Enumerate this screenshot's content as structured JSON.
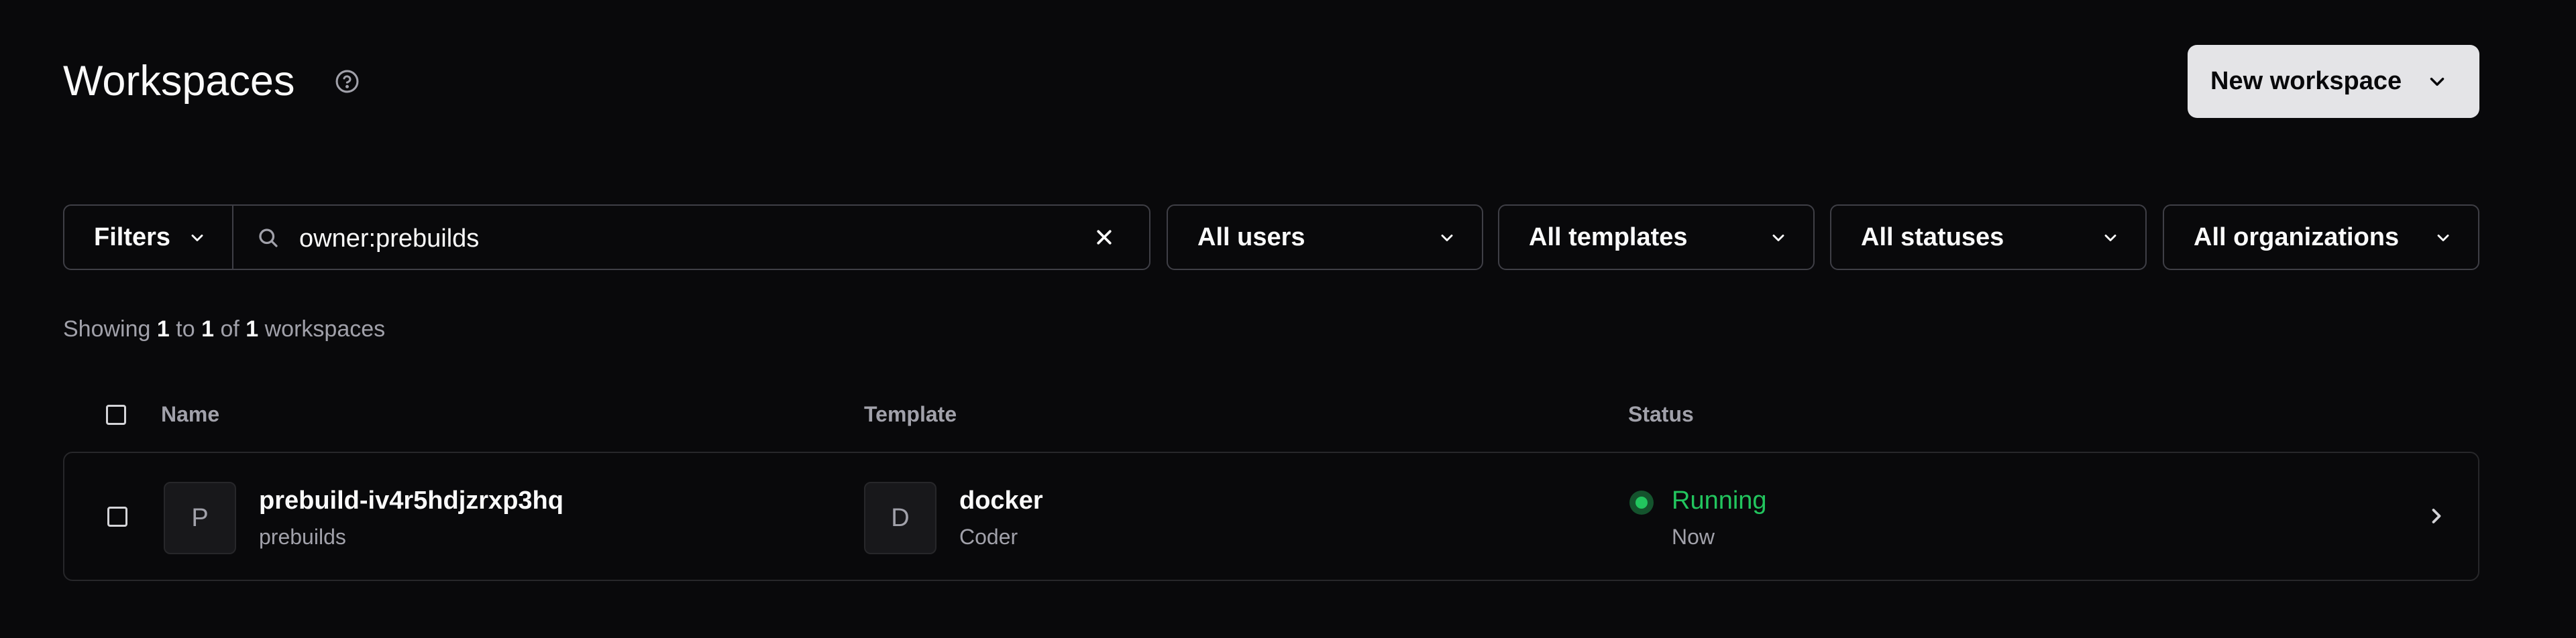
{
  "header": {
    "title": "Workspaces",
    "help_icon": "help-circle-icon",
    "new_workspace_label": "New workspace"
  },
  "filters": {
    "filters_label": "Filters",
    "search_value": "owner:prebuilds",
    "users_label": "All users",
    "templates_label": "All templates",
    "statuses_label": "All statuses",
    "organizations_label": "All organizations"
  },
  "summary": {
    "prefix": "Showing",
    "from": "1",
    "to_word": "to",
    "to": "1",
    "of_word": "of",
    "total": "1",
    "suffix": "workspaces"
  },
  "table": {
    "columns": [
      "Name",
      "Template",
      "Status"
    ],
    "rows": [
      {
        "avatar_letter": "P",
        "name": "prebuild-iv4r5hdjzrxp3hq",
        "owner": "prebuilds",
        "template_letter": "D",
        "template": "docker",
        "organization": "Coder",
        "status": "Running",
        "status_time": "Now"
      }
    ]
  },
  "colors": {
    "background": "#09090b",
    "border": "#3f3f46",
    "running": "#22c55e",
    "button_bg": "#e4e4e7"
  }
}
